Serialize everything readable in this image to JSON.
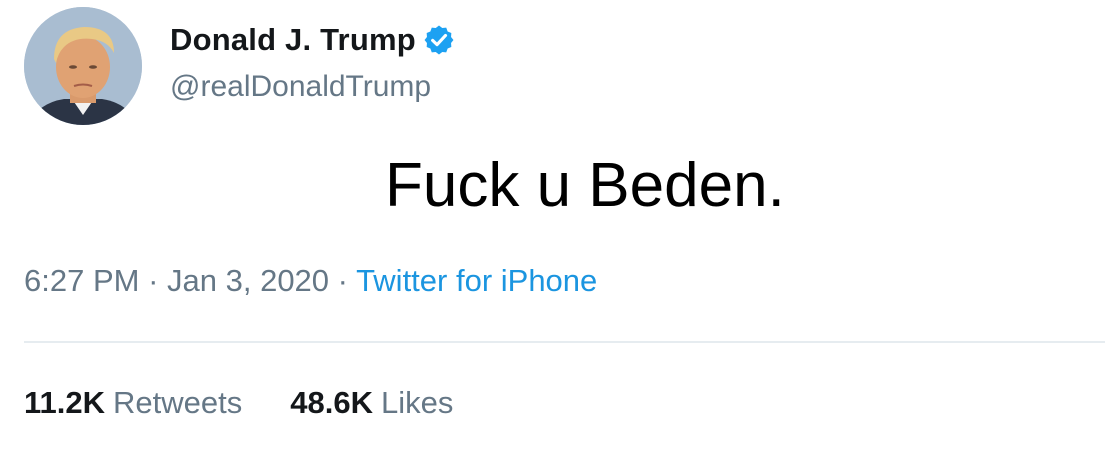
{
  "tweet": {
    "author": {
      "display_name": "Donald J. Trump",
      "handle": "@realDonaldTrump",
      "verified_icon": "verified-badge-icon",
      "avatar_icon": "profile-photo"
    },
    "text": "Fuck u Beden.",
    "meta": {
      "time": "6:27 PM",
      "separator": "·",
      "date": "Jan 3, 2020",
      "source": "Twitter for iPhone"
    },
    "stats": {
      "retweets_count": "11.2K",
      "retweets_label": "Retweets",
      "likes_count": "48.6K",
      "likes_label": "Likes"
    }
  },
  "colors": {
    "text_primary": "#14171a",
    "text_secondary": "#657786",
    "link": "#1b95e0",
    "verified": "#1da1f2",
    "divider": "#e6ecf0"
  }
}
